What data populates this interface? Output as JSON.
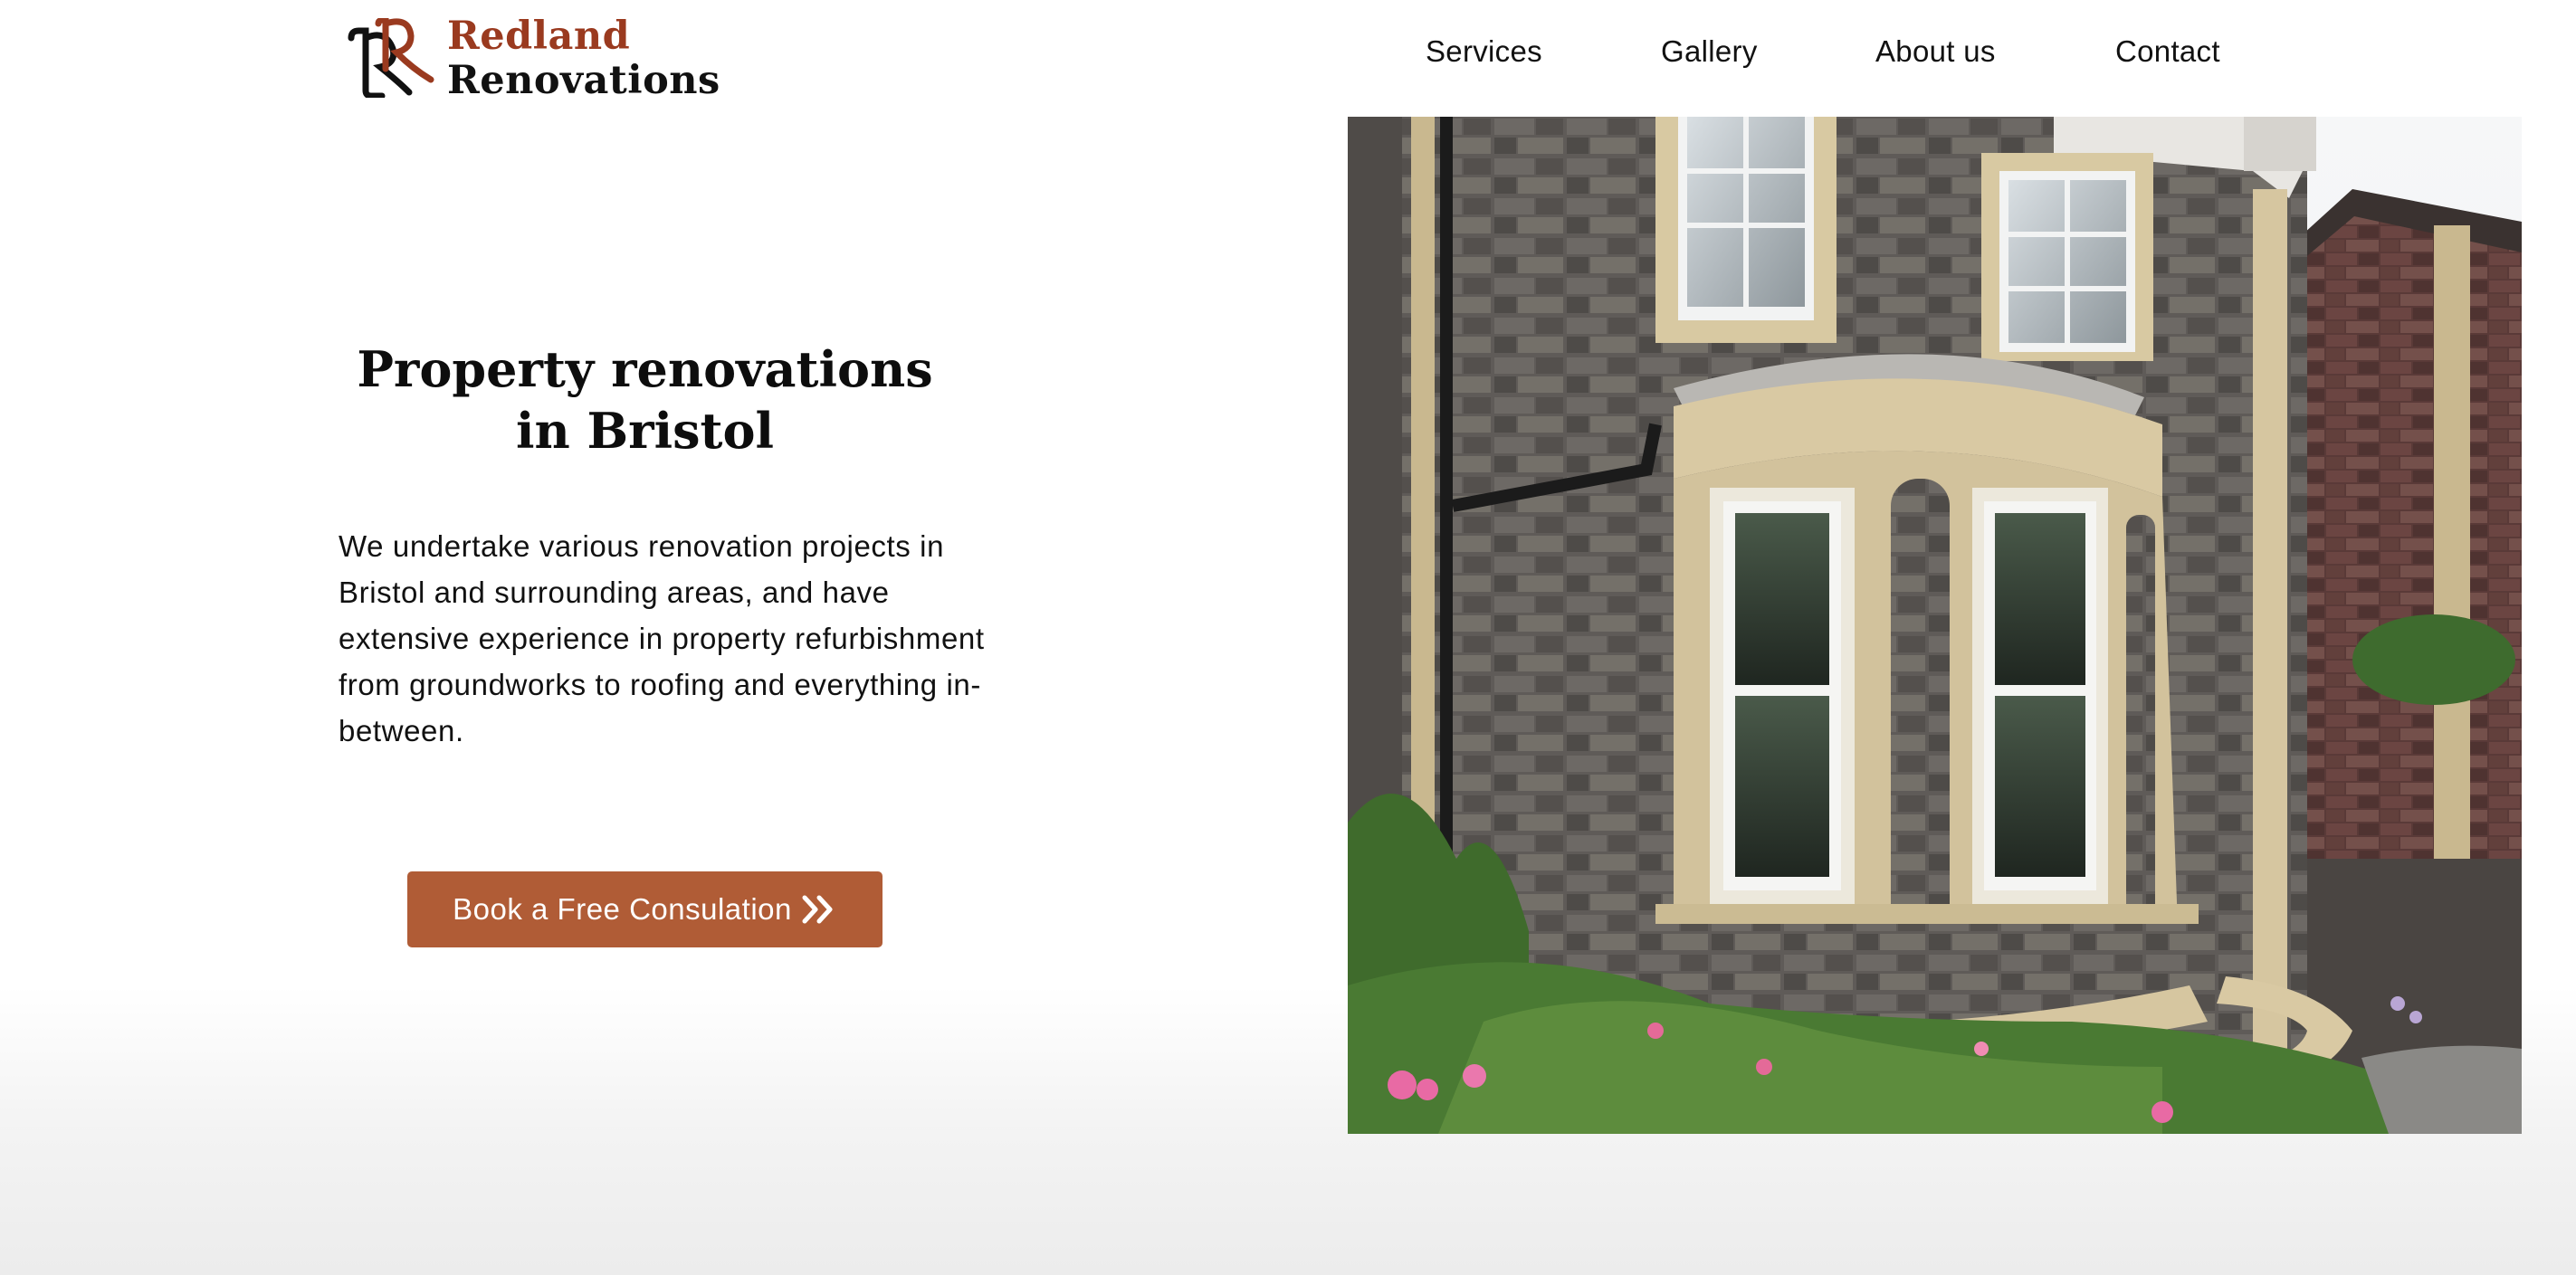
{
  "brand": {
    "name_line1": "Redland",
    "name_line2": "Renovations",
    "accent_color": "#9a3a1f",
    "logo_icon": "rr-monogram-icon"
  },
  "nav": {
    "items": [
      {
        "label": "Services"
      },
      {
        "label": "Gallery"
      },
      {
        "label": "About us"
      },
      {
        "label": "Contact"
      }
    ]
  },
  "hero": {
    "title_line1": "Property renovations",
    "title_line2": "in Bristol",
    "body": "We undertake various renovation projects in Bristol and surrounding areas, and have extensive experience in property refurbishment from groundworks to roofing and everything in-between.",
    "cta_label": "Book a Free Consulation",
    "cta_icon": "double-chevron-right-icon",
    "cta_color": "#b05c36",
    "image_subject": "stone-house-bay-window-photo"
  }
}
